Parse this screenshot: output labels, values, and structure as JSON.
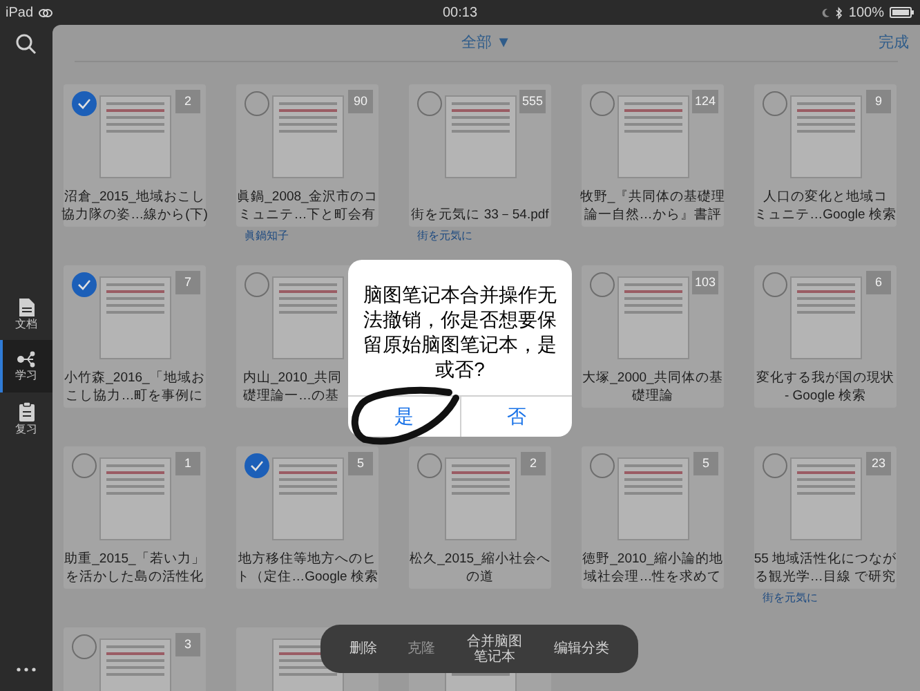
{
  "status_bar": {
    "device": "iPad",
    "time": "00:13",
    "battery": "100%"
  },
  "sidebar": {
    "items": [
      {
        "kind": "document",
        "label": "文档",
        "selected": false
      },
      {
        "kind": "study",
        "label": "学习",
        "selected": true
      },
      {
        "kind": "review",
        "label": "复习",
        "selected": false
      }
    ]
  },
  "header": {
    "filter": "全部 ▼",
    "done": "完成"
  },
  "documents": [
    {
      "lines": [
        "沼倉_2015_地域おこし",
        "協力隊の姿…線から(下)"
      ],
      "count": "2",
      "selected": true
    },
    {
      "lines": [
        "眞鍋_2008_金沢市のコ",
        "ミュニテ…下と町会有"
      ],
      "count": "90",
      "selected": false,
      "subtitle": "眞鍋知子"
    },
    {
      "lines": [
        "街を元気に 33－54.pdf"
      ],
      "count": "555",
      "selected": false,
      "subtitle": "街を元気に"
    },
    {
      "lines": [
        "牧野_『共同体の基礎理",
        "論一自然…から』書評"
      ],
      "count": "124",
      "selected": false
    },
    {
      "lines": [
        "人口の変化と地域コ",
        "ミュニテ…Google 検索"
      ],
      "count": "9",
      "selected": false
    },
    {
      "lines": [
        "小竹森_2016_「地域お",
        "こし協力…町を事例に"
      ],
      "count": "7",
      "selected": true
    },
    {
      "kind": "cut",
      "lines": [
        "内山_2010_共同",
        "礎理論一…の基"
      ],
      "selected": false
    },
    {
      "kind": "covered"
    },
    {
      "lines": [
        "大塚_2000_共同体の基",
        "礎理論"
      ],
      "count": "103",
      "selected": false
    },
    {
      "lines": [
        "変化する我が国の現状",
        "- Google 検索"
      ],
      "count": "6",
      "selected": false
    },
    {
      "lines": [
        "助重_2015_「若い力」",
        "を活かした島の活性化"
      ],
      "count": "1",
      "selected": false
    },
    {
      "lines": [
        "地方移住等地方へのヒ",
        "ト（定住…Google 検索"
      ],
      "count": "5",
      "selected": true
    },
    {
      "lines": [
        "松久_2015_縮小社会へ",
        "の道"
      ],
      "count": "2",
      "selected": false
    },
    {
      "lines": [
        "徳野_2010_縮小論的地",
        "域社会理…性を求めて"
      ],
      "count": "5",
      "selected": false
    },
    {
      "lines": [
        "55 地域活性化につなが",
        "る観光学…目線 で研究"
      ],
      "count": "23",
      "selected": false,
      "subtitle": "街を元気に"
    },
    {
      "count": "3",
      "selected": false
    },
    {
      "kind": "card"
    },
    {
      "kind": "card"
    }
  ],
  "action_bar": [
    {
      "label": "删除",
      "disabled": false
    },
    {
      "label": "克隆",
      "disabled": true
    },
    {
      "label": "合并脑图笔记本",
      "disabled": false
    },
    {
      "label": "编辑分类",
      "disabled": false
    }
  ],
  "dialog": {
    "message": "脑图笔记本合并操作无法撤销，你是否想要保留原始脑图笔记本，是或否?",
    "buttons": [
      {
        "label": "是"
      },
      {
        "label": "否"
      }
    ]
  }
}
